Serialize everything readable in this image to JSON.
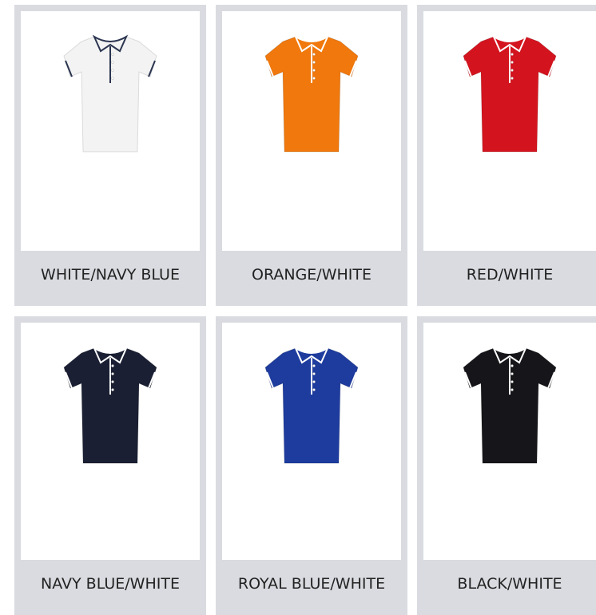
{
  "products": [
    {
      "label": "WHITE/NAVY BLUE",
      "color": "#f3f3f3",
      "trim": "#2b3550"
    },
    {
      "label": "ORANGE/WHITE",
      "color": "#f0780c",
      "trim": "#ffffff"
    },
    {
      "label": "RED/WHITE",
      "color": "#d3141e",
      "trim": "#ffffff"
    },
    {
      "label": "NAVY BLUE/WHITE",
      "color": "#1a1f33",
      "trim": "#ffffff"
    },
    {
      "label": "ROYAL BLUE/WHITE",
      "color": "#1e3c9e",
      "trim": "#ffffff"
    },
    {
      "label": "BLACK/WHITE",
      "color": "#16161a",
      "trim": "#ffffff"
    }
  ]
}
